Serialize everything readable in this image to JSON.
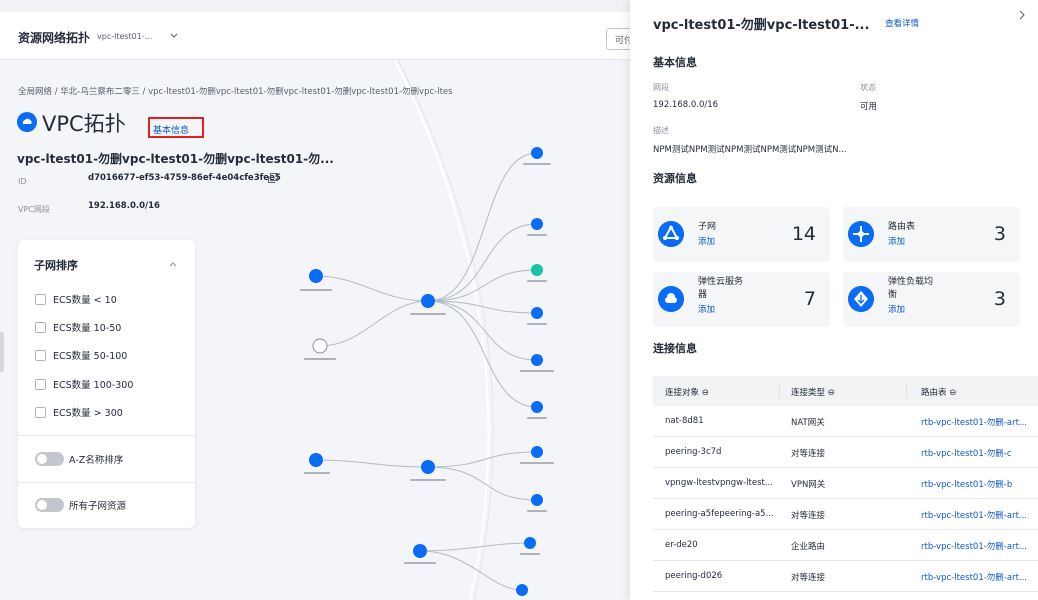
{
  "header": {
    "title": "资源网络拓扑",
    "vpc_select": "vpc-ltest01-...",
    "avail_btn": "可付"
  },
  "breadcrumb": "全局网络 / 华北-乌兰察布二零三 / vpc-ltest01-勿删vpc-ltest01-勿删vpc-ltest01-勿删vpc-ltest01-勿删vpc-ltes",
  "vpc": {
    "title": "VPC拓扑",
    "basic_info_link": "基本信息",
    "name": "vpc-ltest01-勿删vpc-ltest01-勿删vpc-ltest01-勿...",
    "id_label": "ID",
    "id_value": "d7016677-ef53-4759-86ef-4e04cfe3fee5",
    "cidr_label": "VPC网段",
    "cidr_value": "192.168.0.0/16"
  },
  "subnet_panel": {
    "title": "子网排序",
    "filters": [
      "ECS数量 < 10",
      "ECS数量 10-50",
      "ECS数量 50-100",
      "ECS数量 100-300",
      "ECS数量 > 300"
    ],
    "az_sort": "A-Z名称排序",
    "all_subnets": "所有子网资源"
  },
  "drawer": {
    "title": "vpc-ltest01-勿删vpc-ltest01-...",
    "detail_link": "查看详情",
    "basic_section": "基本信息",
    "cidr_label": "网段",
    "cidr_value": "192.168.0.0/16",
    "status_label": "状态",
    "status_value": "可用",
    "desc_label": "描述",
    "desc_value": "NPM测试NPM测试NPM测试NPM测试NPM测试N...",
    "resource_section": "资源信息",
    "resources": [
      {
        "name": "子网",
        "add": "添加",
        "count": "14"
      },
      {
        "name": "路由表",
        "add": "添加",
        "count": "3"
      },
      {
        "name": "弹性云服务器",
        "name_line1": "弹性云服务",
        "name_line2": "器",
        "add": "添加",
        "count": "7"
      },
      {
        "name": "弹性负载均衡",
        "name_line1": "弹性负载均",
        "name_line2": "衡",
        "add": "添加",
        "count": "3"
      }
    ],
    "connection_section": "连接信息",
    "table_headers": [
      "连接对象",
      "连接类型",
      "路由表"
    ],
    "rows": [
      [
        "nat-8d81",
        "NAT网关",
        "rtb-vpc-ltest01-勿删-art..."
      ],
      [
        "peering-3c7d",
        "对等连接",
        "rtb-vpc-ltest01-勿删-c"
      ],
      [
        "vpngw-ltestvpngw-ltest...",
        "VPN网关",
        "rtb-vpc-ltest01-勿删-b"
      ],
      [
        "peering-a5fepeering-a5...",
        "对等连接",
        "rtb-vpc-ltest01-勿删-art..."
      ],
      [
        "er-de20",
        "企业路由",
        "rtb-vpc-ltest01-勿删-art..."
      ],
      [
        "peering-d026",
        "对等连接",
        "rtb-vpc-ltest01-勿删-art..."
      ]
    ]
  },
  "colors": {
    "accent": "#0a6cf5",
    "link": "#0a58ce",
    "teal": "#17c3a5",
    "highlight_border": "#e02020"
  }
}
